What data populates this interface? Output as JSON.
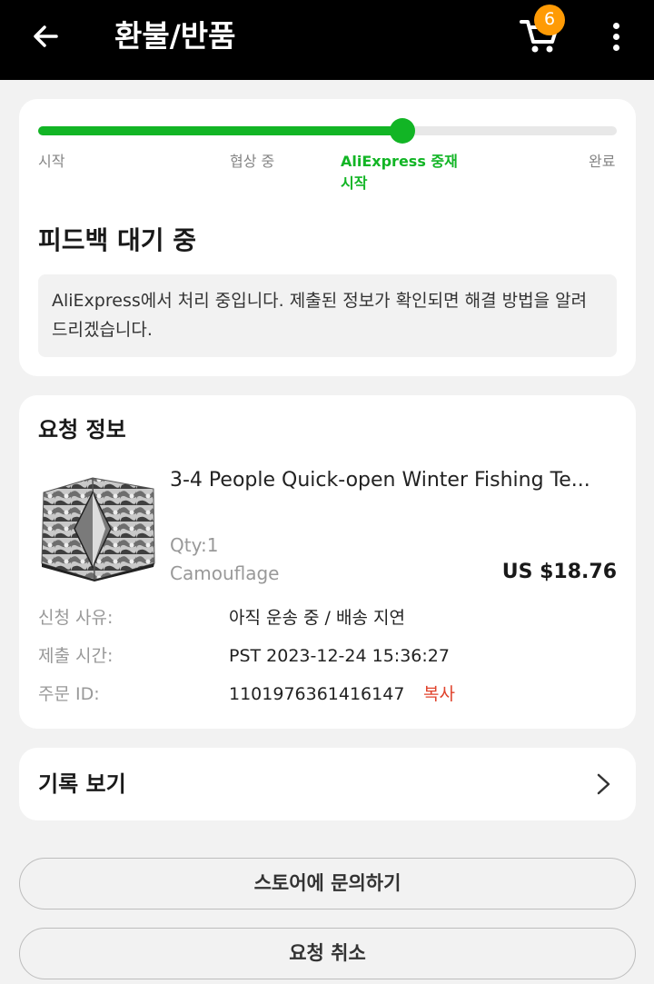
{
  "header": {
    "title": "환불/반품",
    "cart_count": "6"
  },
  "progress": {
    "steps": [
      "시작",
      "협상 중",
      "AliExpress 중재 시작",
      "완료"
    ],
    "current_step_index": 2,
    "active_color": "#12b525"
  },
  "status": {
    "title": "피드백 대기 중",
    "message": "AliExpress에서 처리 중입니다. 제출된 정보가 확인되면 해결 방법을 알려드리겠습니다."
  },
  "request": {
    "title": "요청 정보",
    "product": {
      "name": "3-4 People Quick-open Winter Fishing Te...",
      "qty": "Qty:1",
      "variant": "Camouflage",
      "price": "US $18.76"
    },
    "rows": [
      {
        "label": "신청 사유:",
        "value": "아직 운송 중 / 배송 지연"
      },
      {
        "label": "제출 시간:",
        "value": "PST 2023-12-24 15:36:27"
      },
      {
        "label": "주문 ID:",
        "value": "1101976361416147"
      }
    ],
    "copy_label": "복사"
  },
  "history": {
    "label": "기록 보기"
  },
  "actions": {
    "contact_store": "스토어에 문의하기",
    "cancel_request": "요청 취소"
  }
}
